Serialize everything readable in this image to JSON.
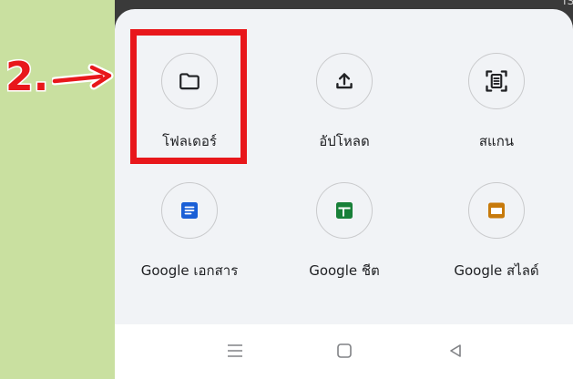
{
  "background": {
    "peek_text": "ISO"
  },
  "sheet": {
    "items": [
      {
        "label": "โฟลเดอร์",
        "icon": "folder-icon"
      },
      {
        "label": "อัปโหลด",
        "icon": "upload-icon"
      },
      {
        "label": "สแกน",
        "icon": "scan-icon"
      },
      {
        "label": "Google เอกสาร",
        "icon": "google-docs-icon"
      },
      {
        "label": "Google ชีต",
        "icon": "google-sheets-icon"
      },
      {
        "label": "Google สไลด์",
        "icon": "google-slides-icon"
      }
    ]
  },
  "annotation": {
    "step": "2.",
    "color": "#e8171b"
  },
  "navbar": {
    "icons": [
      "menu-icon",
      "home-icon",
      "back-icon"
    ]
  },
  "colors": {
    "docs_blue": "#1a5fd6",
    "sheets_green": "#188038",
    "slides_orange": "#c77a0c",
    "sidebar_green": "#c9e0a0"
  }
}
